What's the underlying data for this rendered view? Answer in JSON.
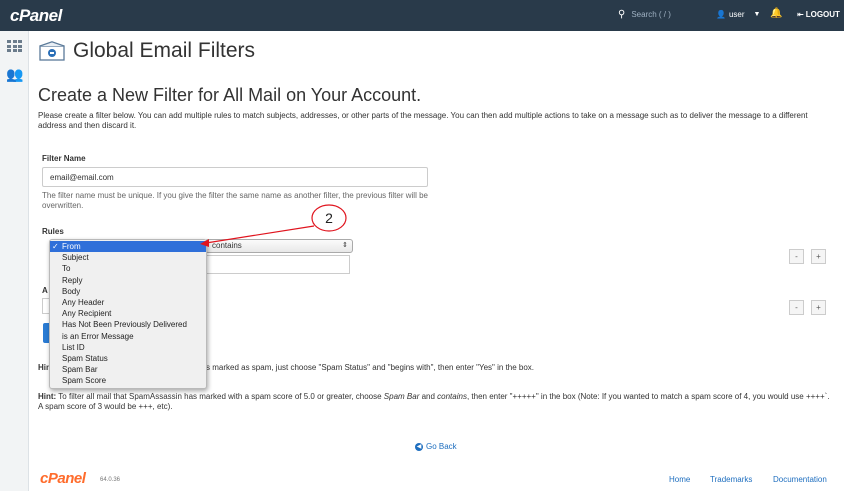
{
  "topbar": {
    "logo": "cPanel",
    "search_placeholder": "Search ( / )",
    "user_label": "user",
    "logout_label": "LOGOUT"
  },
  "page": {
    "title": "Global Email Filters",
    "section_title": "Create a New Filter for All Mail on Your Account.",
    "intro": "Please create a filter below. You can add multiple rules to match subjects, addresses, or other parts of the message. You can then add multiple actions to take on a message such as to deliver the message to a different address and then discard it."
  },
  "form": {
    "filter_name_label": "Filter Name",
    "filter_name_value": "email@email.com",
    "filter_help": "The filter name must be unique. If you give the filter the same name as another filter, the previous filter will be overwritten.",
    "rules_label": "Rules",
    "rule_operator": "contains",
    "actions_stub": "A",
    "minus": "-",
    "plus": "+"
  },
  "dropdown": {
    "options": [
      "From",
      "Subject",
      "To",
      "Reply",
      "Body",
      "Any Header",
      "Any Recipient",
      "Has Not Been Previously Delivered",
      "is an Error Message",
      "List ID",
      "Spam Status",
      "Spam Bar",
      "Spam Score"
    ],
    "selected_check": "✓"
  },
  "hints": {
    "hint_label": "Hin",
    "hint1_tail": "s marked as spam, just choose \"Spam Status\" and \"begins with\", then enter \"Yes\" in the box.",
    "hint2_label": "Hint:",
    "hint2_a": " To filter all mail that SpamAssassin has marked with a spam score of 5.0 or greater, choose ",
    "hint2_em1": "Spam Bar",
    "hint2_b": " and ",
    "hint2_em2": "contains",
    "hint2_c": ", then enter \"+++++\" in the box (Note: If you wanted to match a spam score of 4, you would use ++++`. A spam score of 3 would be +++, etc)."
  },
  "footer": {
    "go_back": "Go Back",
    "logo": "cPanel",
    "version": "64.0.36",
    "links": [
      "Home",
      "Trademarks",
      "Documentation"
    ]
  },
  "annotation": {
    "number": "2",
    "color": "#e0141e"
  }
}
